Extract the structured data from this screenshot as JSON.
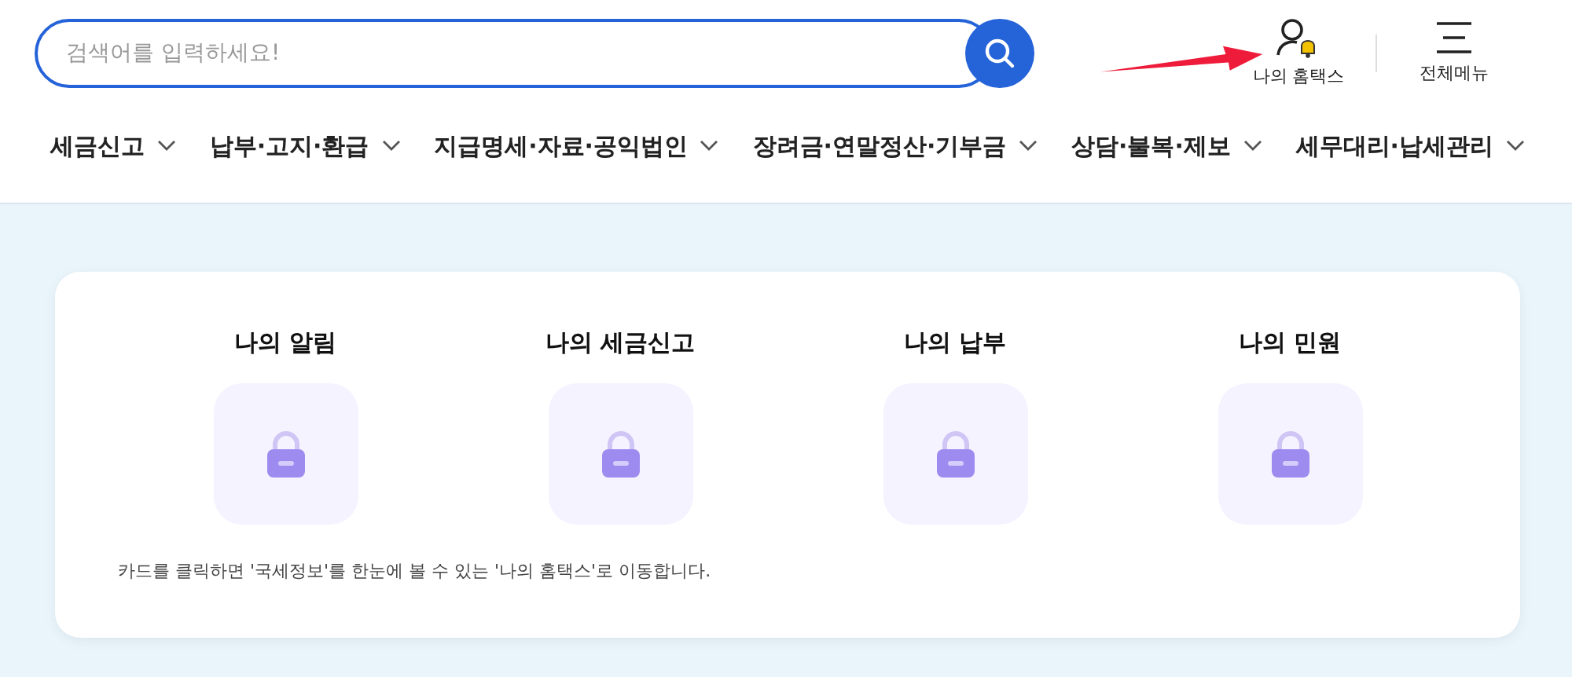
{
  "search": {
    "placeholder": "검색어를 입력하세요!"
  },
  "header_links": [
    {
      "kind": "myhome",
      "label": "나의 홈택스"
    },
    {
      "kind": "menu",
      "label": "전체메뉴"
    }
  ],
  "nav": [
    "세금신고",
    "납부·고지·환급",
    "지급명세·자료·공익법인",
    "장려금·연말정산·기부금",
    "상담·불복·제보",
    "세무대리·납세관리"
  ],
  "cards": [
    {
      "title": "나의 알림"
    },
    {
      "title": "나의 세금신고"
    },
    {
      "title": "나의 납부"
    },
    {
      "title": "나의 민원"
    }
  ],
  "note": "카드를 클릭하면 '국세정보'를 한눈에 볼 수 있는 '나의 홈택스'로 이동합니다."
}
